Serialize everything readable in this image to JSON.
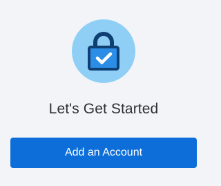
{
  "hero": {
    "icon": "lock-check-icon",
    "circle_color": "#8fcff6",
    "icon_outline_color": "#0f3f73",
    "icon_fill_color": "#2c8de6"
  },
  "headline": "Let's Get Started",
  "primary_action": {
    "label": "Add an Account",
    "color": "#0d6ed9"
  }
}
